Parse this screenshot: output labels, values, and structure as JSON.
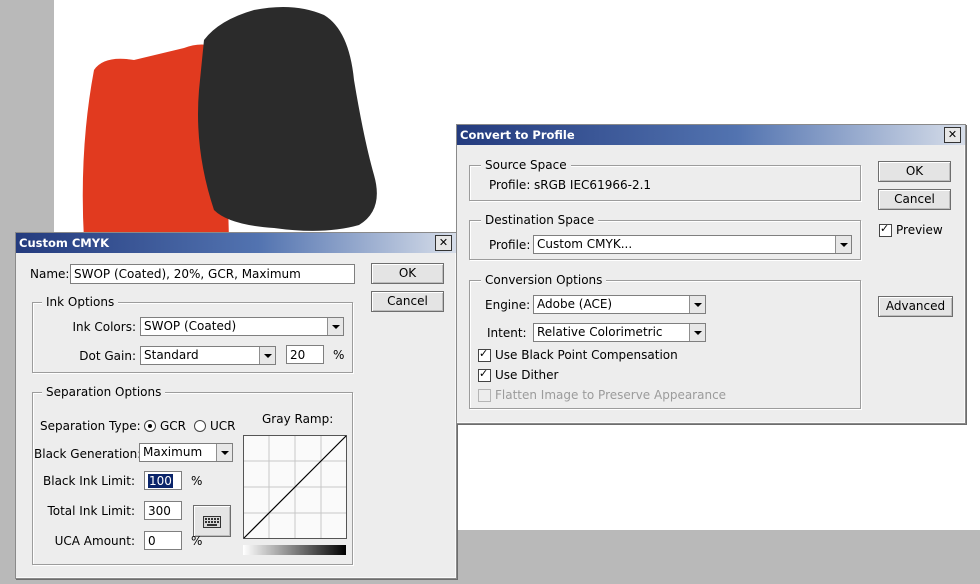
{
  "custom_cmyk": {
    "title": "Custom CMYK",
    "close_label": "✕",
    "name_label": "Name:",
    "name_value": "SWOP (Coated), 20%, GCR, Maximum",
    "ok_label": "OK",
    "cancel_label": "Cancel",
    "ink_options": {
      "legend": "Ink Options",
      "ink_colors_label": "Ink Colors:",
      "ink_colors_value": "SWOP (Coated)",
      "dot_gain_label": "Dot Gain:",
      "dot_gain_value": "Standard",
      "dot_gain_percent": "20",
      "percent_sign": "%"
    },
    "separation": {
      "legend": "Separation Options",
      "type_label": "Separation Type:",
      "gcr_label": "GCR",
      "ucr_label": "UCR",
      "selected_type": "GCR",
      "gray_ramp_label": "Gray Ramp:",
      "black_generation_label": "Black Generation:",
      "black_generation_value": "Maximum",
      "black_ink_limit_label": "Black Ink Limit:",
      "black_ink_limit_value": "100",
      "total_ink_limit_label": "Total Ink Limit:",
      "total_ink_limit_value": "300",
      "uca_amount_label": "UCA Amount:",
      "uca_amount_value": "0",
      "percent_sign": "%"
    },
    "icons": {
      "ramp_button": "keyboard-icon"
    }
  },
  "convert_to_profile": {
    "title": "Convert to Profile",
    "close_label": "✕",
    "ok_label": "OK",
    "cancel_label": "Cancel",
    "preview_label": "Preview",
    "preview_checked": true,
    "advanced_label": "Advanced",
    "source_space": {
      "legend": "Source Space",
      "profile_label": "Profile:",
      "profile_value": "sRGB IEC61966-2.1"
    },
    "destination_space": {
      "legend": "Destination Space",
      "profile_label": "Profile:",
      "profile_value": "Custom CMYK..."
    },
    "conversion_options": {
      "legend": "Conversion Options",
      "engine_label": "Engine:",
      "engine_value": "Adobe (ACE)",
      "intent_label": "Intent:",
      "intent_value": "Relative Colorimetric",
      "black_point_label": "Use Black Point Compensation",
      "black_point_checked": true,
      "dither_label": "Use Dither",
      "dither_checked": true,
      "flatten_label": "Flatten Image to Preserve Appearance",
      "flatten_enabled": false
    }
  },
  "colors": {
    "canvas_red": "#e13a1f",
    "canvas_black": "#2b2b2b",
    "title_gradient_start": "#243b7e",
    "title_gradient_end": "#d6dde9"
  }
}
